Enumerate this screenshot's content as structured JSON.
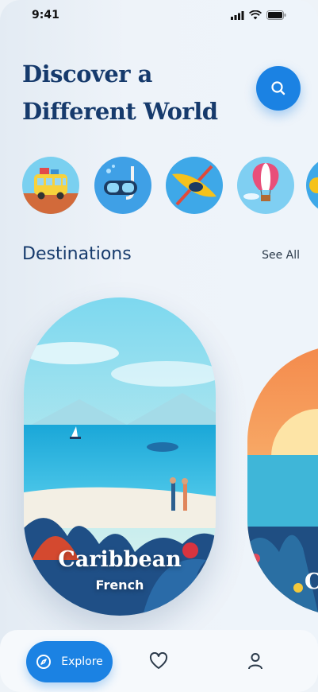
{
  "status_bar": {
    "time": "9:41"
  },
  "header": {
    "title_line1": "Discover a",
    "title_line2": "Different World"
  },
  "categories": [
    {
      "name": "Road Trip",
      "icon": "bus-icon"
    },
    {
      "name": "Diving",
      "icon": "snorkel-mask-icon"
    },
    {
      "name": "Kayaking",
      "icon": "kayak-icon"
    },
    {
      "name": "Hot Air Balloon",
      "icon": "hot-air-balloon-icon"
    }
  ],
  "destinations": {
    "title": "Destinations",
    "see_all": "See All",
    "cards": [
      {
        "name": "Caribbean",
        "subtitle": "French"
      },
      {
        "name": "C",
        "subtitle": ""
      }
    ]
  },
  "nav": {
    "explore_label": "Explore"
  },
  "colors": {
    "accent": "#1b82e3",
    "heading": "#163a6c",
    "background": "#eef3f8"
  }
}
